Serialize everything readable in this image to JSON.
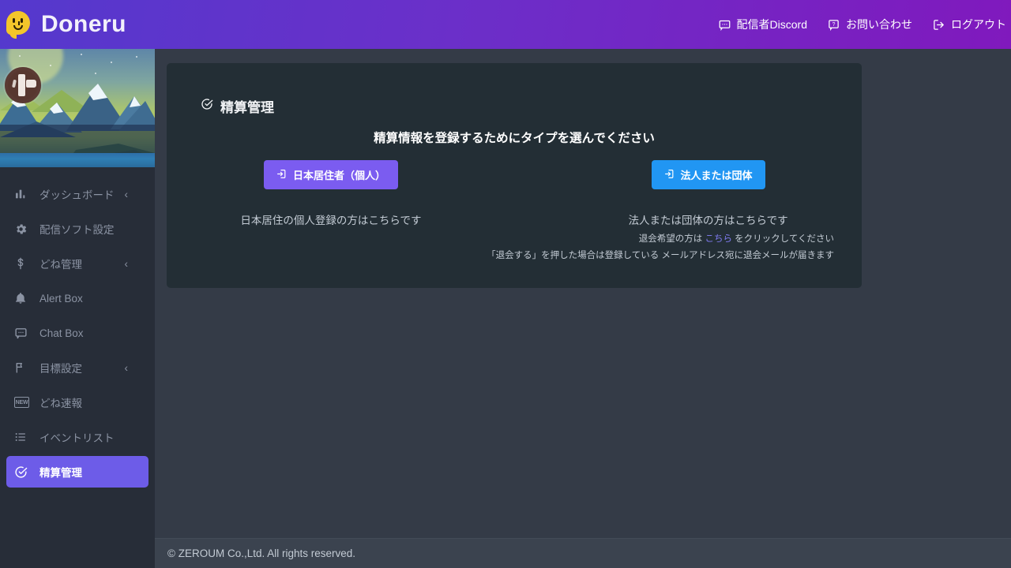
{
  "header": {
    "brand": "Doneru",
    "brand_icon": "doneru-smiley-logo-icon",
    "nav": [
      {
        "label": "配信者Discord",
        "icon": "chat-bubble-icon"
      },
      {
        "label": "お問い合わせ",
        "icon": "question-bubble-icon"
      },
      {
        "label": "ログアウト",
        "icon": "logout-icon"
      }
    ]
  },
  "sidebar": {
    "avatar_alt": "user-avatar",
    "items": [
      {
        "label": "ダッシュボード",
        "icon": "bar-chart-icon",
        "chevron": "‹",
        "active": false
      },
      {
        "label": "配信ソフト設定",
        "icon": "gear-icon",
        "chevron": "",
        "active": false
      },
      {
        "label": "どね管理",
        "icon": "dollar-icon",
        "chevron": "‹",
        "active": false
      },
      {
        "label": "Alert Box",
        "icon": "bell-icon",
        "chevron": "",
        "active": false
      },
      {
        "label": "Chat Box",
        "icon": "chat-box-icon",
        "chevron": "",
        "active": false
      },
      {
        "label": "目標設定",
        "icon": "flag-icon",
        "chevron": "‹",
        "active": false
      },
      {
        "label": "どね速報",
        "icon": "new-badge-icon",
        "chevron": "",
        "active": false
      },
      {
        "label": "イベントリスト",
        "icon": "list-icon",
        "chevron": "",
        "active": false
      },
      {
        "label": "精算管理",
        "icon": "check-circle-icon",
        "chevron": "",
        "active": true
      }
    ]
  },
  "card": {
    "title": "精算管理",
    "title_icon": "check-circle-icon",
    "heading": "精算情報を登録するためにタイプを選んでください",
    "choices": [
      {
        "button_label": "日本居住者（個人）",
        "button_icon": "login-arrow-icon",
        "description": "日本居住の個人登録の方はこちらです"
      },
      {
        "button_label": "法人または団体",
        "button_icon": "login-arrow-icon",
        "description": "法人または団体の方はこちらです"
      }
    ],
    "fineprint": {
      "line1_before": "退会希望の方は ",
      "line1_link": "こちら",
      "line1_after": " をクリックしてください",
      "line2": "「退会する」を押した場合は登録している メールアドレス宛に退会メールが届きます"
    }
  },
  "footer": {
    "copyright": "© ZEROUM Co.,Ltd. All rights reserved."
  },
  "colors": {
    "header_gradient_start": "#5439cd",
    "header_gradient_end": "#8019bd",
    "page_bg": "#343b47",
    "card_bg": "#232e35",
    "sidebar_bg": "#272d38",
    "sidebar_active": "#6d5ce8",
    "btn_personal": "#7b5cf0",
    "btn_corp": "#2196f3",
    "link": "#7f7bf0",
    "footer_bg": "#3b434f"
  }
}
